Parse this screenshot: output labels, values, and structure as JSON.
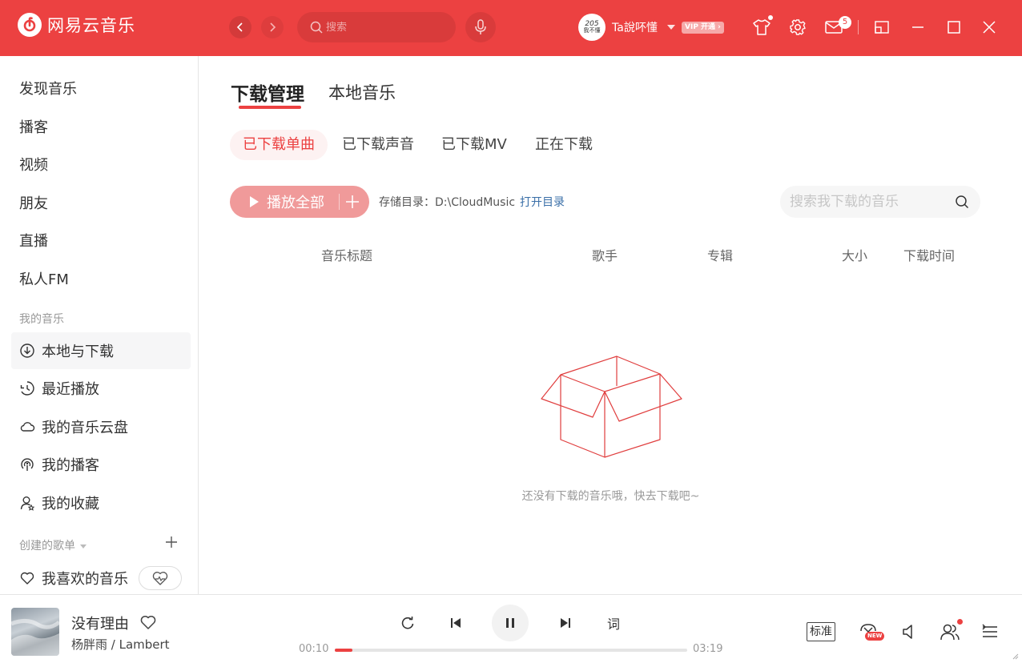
{
  "app": {
    "name": "网易云音乐",
    "brand_color": "#ec4141"
  },
  "header": {
    "search_placeholder": "搜索",
    "username": "Ta說吥懂",
    "avatar_text_top": "205",
    "avatar_text_bottom": "我不懂",
    "vip_label": "VIP 开通 ›",
    "mail_count": "5"
  },
  "sidebar": {
    "main_items": [
      "发现音乐",
      "播客",
      "视频",
      "朋友",
      "直播",
      "私人FM"
    ],
    "my_music_label": "我的音乐",
    "my_music_items": [
      {
        "label": "本地与下载",
        "icon": "download-icon"
      },
      {
        "label": "最近播放",
        "icon": "recent-clock-icon"
      },
      {
        "label": "我的音乐云盘",
        "icon": "cloud-icon"
      },
      {
        "label": "我的播客",
        "icon": "podcast-icon"
      },
      {
        "label": "我的收藏",
        "icon": "collect-user-icon"
      }
    ],
    "created_playlists_label": "创建的歌单",
    "liked_music_label": "我喜欢的音乐"
  },
  "main": {
    "tabs": [
      "下载管理",
      "本地音乐"
    ],
    "sub_tabs": [
      "已下载单曲",
      "已下载声音",
      "已下载MV",
      "正在下载"
    ],
    "play_all_label": "播放全部",
    "storage_label": "存储目录：",
    "storage_path": "D:\\CloudMusic",
    "open_dir_label": "打开目录",
    "local_search_placeholder": "搜索我下载的音乐",
    "columns": [
      "音乐标题",
      "歌手",
      "专辑",
      "大小",
      "下载时间"
    ],
    "empty_text": "还没有下载的音乐哦，快去下载吧~"
  },
  "player": {
    "song_title": "没有理由",
    "song_artist": "杨胖雨 / Lambert",
    "current_time": "00:10",
    "total_time": "03:19",
    "progress": 0.05,
    "lyrics_label": "词",
    "quality_label": "标准",
    "new_tag": "NEW"
  }
}
